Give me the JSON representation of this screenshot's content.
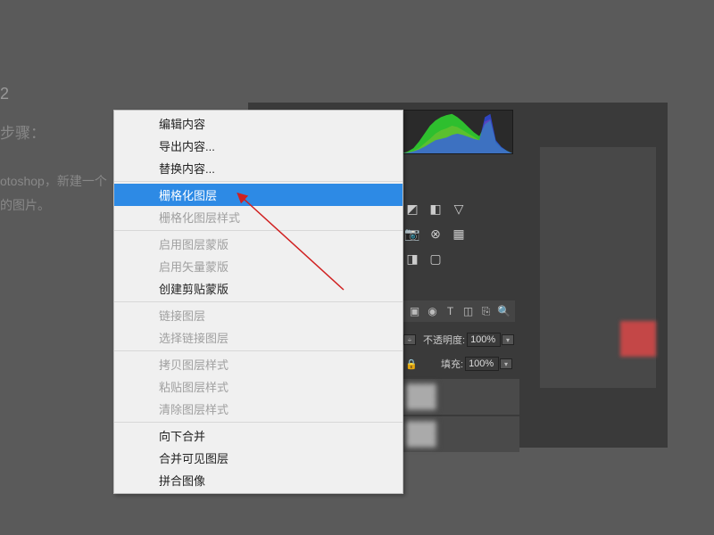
{
  "bg": {
    "num": "2",
    "step": "步骤：",
    "line1": "otoshop，新建一个",
    "line2": "的图片。"
  },
  "menu": {
    "sections": [
      {
        "items": [
          {
            "label": "编辑内容",
            "disabled": false
          },
          {
            "label": "导出内容...",
            "disabled": false
          },
          {
            "label": "替换内容...",
            "disabled": false
          }
        ]
      },
      {
        "items": [
          {
            "label": "栅格化图层",
            "disabled": false,
            "highlighted": true
          },
          {
            "label": "栅格化图层样式",
            "disabled": true
          }
        ]
      },
      {
        "items": [
          {
            "label": "启用图层蒙版",
            "disabled": true
          },
          {
            "label": "启用矢量蒙版",
            "disabled": true
          },
          {
            "label": "创建剪贴蒙版",
            "disabled": false
          }
        ]
      },
      {
        "items": [
          {
            "label": "链接图层",
            "disabled": true
          },
          {
            "label": "选择链接图层",
            "disabled": true
          }
        ]
      },
      {
        "items": [
          {
            "label": "拷贝图层样式",
            "disabled": true
          },
          {
            "label": "粘贴图层样式",
            "disabled": true
          },
          {
            "label": "清除图层样式",
            "disabled": true
          }
        ]
      },
      {
        "items": [
          {
            "label": "向下合并",
            "disabled": false
          },
          {
            "label": "合并可见图层",
            "disabled": false
          },
          {
            "label": "拼合图像",
            "disabled": false
          }
        ]
      }
    ]
  },
  "layers_panel": {
    "opacity_label": "不透明度:",
    "opacity_value": "100%",
    "fill_label": "填充:",
    "fill_value": "100%"
  },
  "chart_data": {
    "type": "area",
    "title": "",
    "xlabel": "",
    "ylabel": "",
    "x": [
      0,
      5,
      10,
      15,
      20,
      25,
      30,
      35,
      40,
      45,
      50,
      55,
      60,
      65,
      70,
      75,
      80,
      85,
      90,
      95,
      100
    ],
    "series": [
      {
        "name": "red",
        "color": "#ff3030",
        "values": [
          0,
          2,
          4,
          8,
          15,
          22,
          30,
          35,
          38,
          42,
          40,
          35,
          30,
          25,
          20,
          48,
          52,
          15,
          8,
          3,
          0
        ]
      },
      {
        "name": "green",
        "color": "#30ff30",
        "values": [
          0,
          3,
          8,
          18,
          30,
          42,
          50,
          55,
          58,
          60,
          55,
          48,
          40,
          32,
          26,
          44,
          50,
          18,
          9,
          4,
          0
        ]
      },
      {
        "name": "blue",
        "color": "#3050ff",
        "values": [
          0,
          1,
          3,
          6,
          10,
          15,
          20,
          22,
          24,
          28,
          30,
          28,
          25,
          22,
          20,
          55,
          60,
          20,
          10,
          4,
          0
        ]
      }
    ],
    "ylim": [
      0,
      65
    ]
  }
}
